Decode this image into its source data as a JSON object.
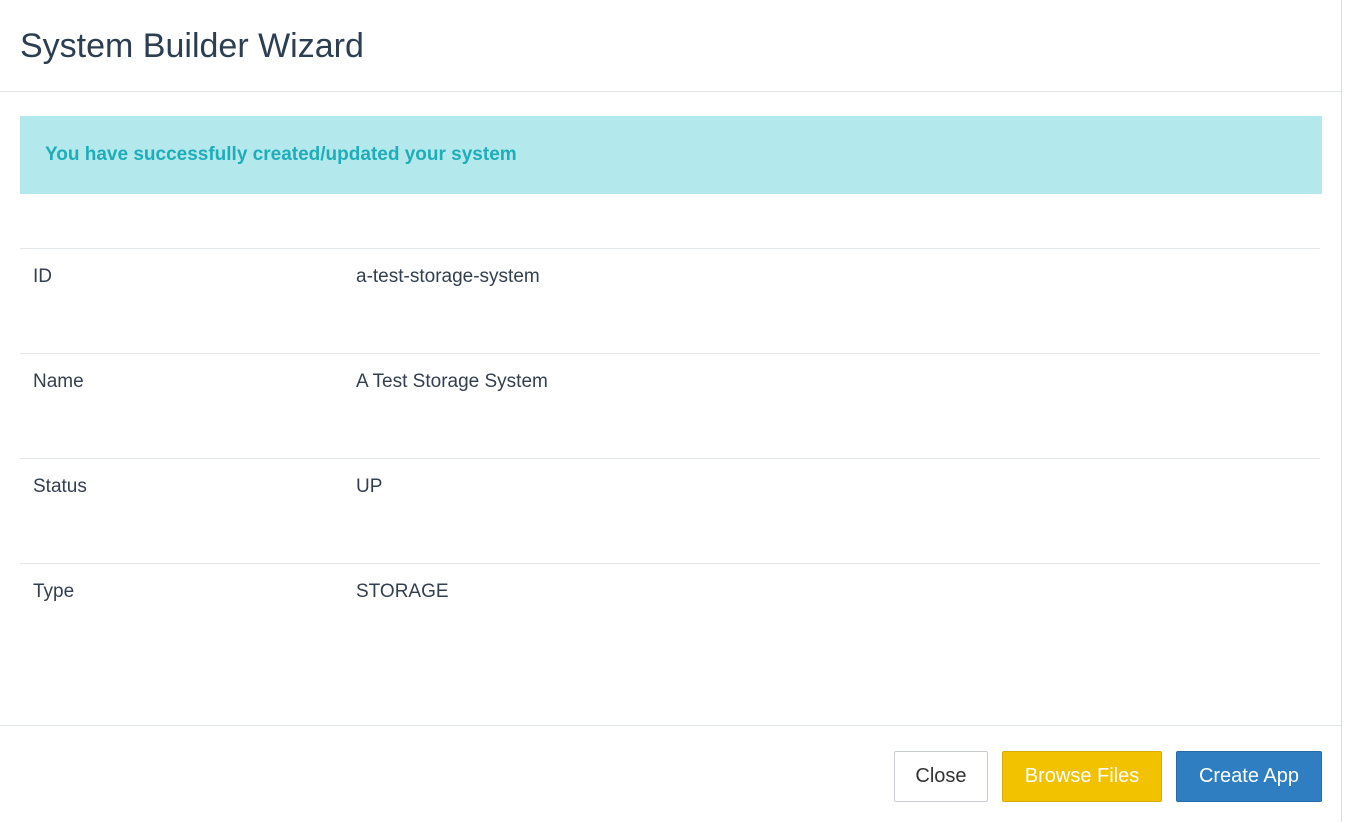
{
  "header": {
    "title": "System Builder Wizard"
  },
  "alert": {
    "message": "You have successfully created/updated your system"
  },
  "details": [
    {
      "label": "ID",
      "value": "a-test-storage-system"
    },
    {
      "label": "Name",
      "value": "A Test Storage System"
    },
    {
      "label": "Status",
      "value": "UP"
    },
    {
      "label": "Type",
      "value": "STORAGE"
    }
  ],
  "footer": {
    "close_label": "Close",
    "browse_label": "Browse Files",
    "create_label": "Create App"
  },
  "colors": {
    "alert_bg": "#b3e8ed",
    "alert_text": "#1fadb8",
    "browse_button": "#f2c200",
    "create_button": "#2e7ec1"
  }
}
